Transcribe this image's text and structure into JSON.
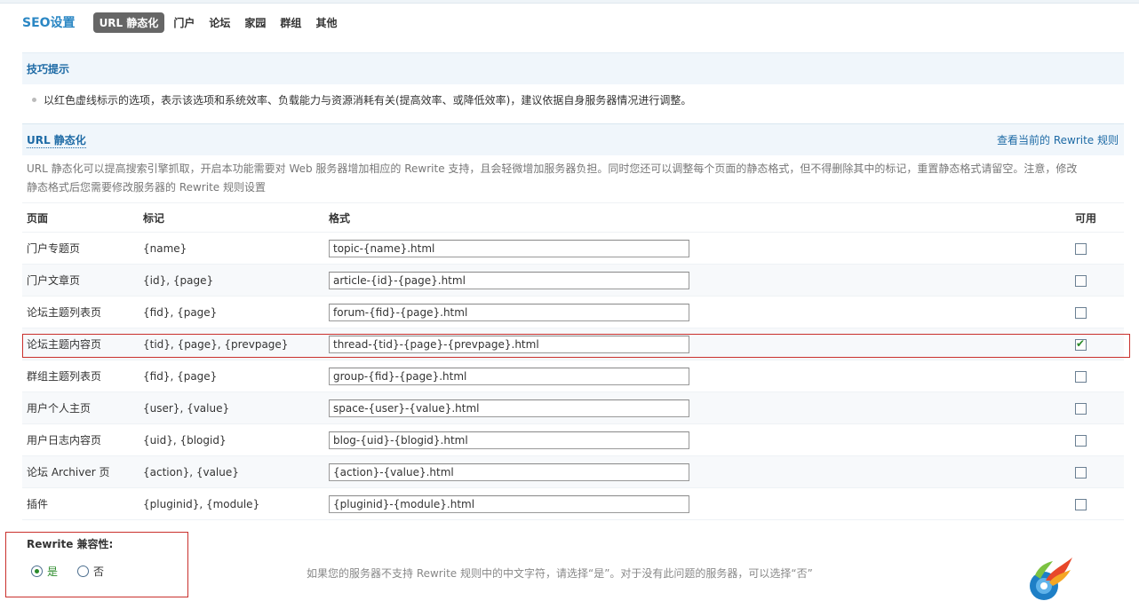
{
  "nav": {
    "title": "SEO设置",
    "tabs": [
      {
        "label": "URL 静态化",
        "active": true
      },
      {
        "label": "门户"
      },
      {
        "label": "论坛"
      },
      {
        "label": "家园"
      },
      {
        "label": "群组"
      },
      {
        "label": "其他"
      }
    ]
  },
  "tips": {
    "heading": "技巧提示",
    "text": "以红色虚线标示的选项，表示该选项和系统效率、负载能力与资源消耗有关(提高效率、或降低效率)，建议依据自身服务器情况进行调整。"
  },
  "url": {
    "heading": "URL 静态化",
    "rules_link": "查看当前的 Rewrite 规则",
    "description": "URL 静态化可以提高搜索引擎抓取，开启本功能需要对 Web 服务器增加相应的 Rewrite 支持，且会轻微增加服务器负担。同时您还可以调整每个页面的静态格式，但不得删除其中的标记，重置静态格式请留空。注意，修改静态格式后您需要修改服务器的 Rewrite 规则设置"
  },
  "table": {
    "headers": {
      "page": "页面",
      "mark": "标记",
      "format": "格式",
      "enabled": "可用"
    },
    "rows": [
      {
        "page": "门户专题页",
        "mark": "{name}",
        "format": "topic-{name}.html",
        "enabled": false
      },
      {
        "page": "门户文章页",
        "mark": "{id}, {page}",
        "format": "article-{id}-{page}.html",
        "enabled": false
      },
      {
        "page": "论坛主题列表页",
        "mark": "{fid}, {page}",
        "format": "forum-{fid}-{page}.html",
        "enabled": false
      },
      {
        "page": "论坛主题内容页",
        "mark": "{tid}, {page}, {prevpage}",
        "format": "thread-{tid}-{page}-{prevpage}.html",
        "enabled": true
      },
      {
        "page": "群组主题列表页",
        "mark": "{fid}, {page}",
        "format": "group-{fid}-{page}.html",
        "enabled": false
      },
      {
        "page": "用户个人主页",
        "mark": "{user}, {value}",
        "format": "space-{user}-{value}.html",
        "enabled": false
      },
      {
        "page": "用户日志内容页",
        "mark": "{uid}, {blogid}",
        "format": "blog-{uid}-{blogid}.html",
        "enabled": false
      },
      {
        "page": "论坛 Archiver 页",
        "mark": "{action}, {value}",
        "format": "{action}-{value}.html",
        "enabled": false
      },
      {
        "page": "插件",
        "mark": "{pluginid}, {module}",
        "format": "{pluginid}-{module}.html",
        "enabled": false
      }
    ]
  },
  "compat": {
    "title": "Rewrite 兼容性:",
    "option_yes": "是",
    "option_no": "否",
    "selected": "yes",
    "note": "如果您的服务器不支持 Rewrite 规则中的中文字符，请选择“是”。对于没有此问题的服务器，可以选择“否”"
  },
  "colors": {
    "accent": "#2b87c4",
    "highlight_border": "#c9302c",
    "checked": "#2a8a2a"
  }
}
